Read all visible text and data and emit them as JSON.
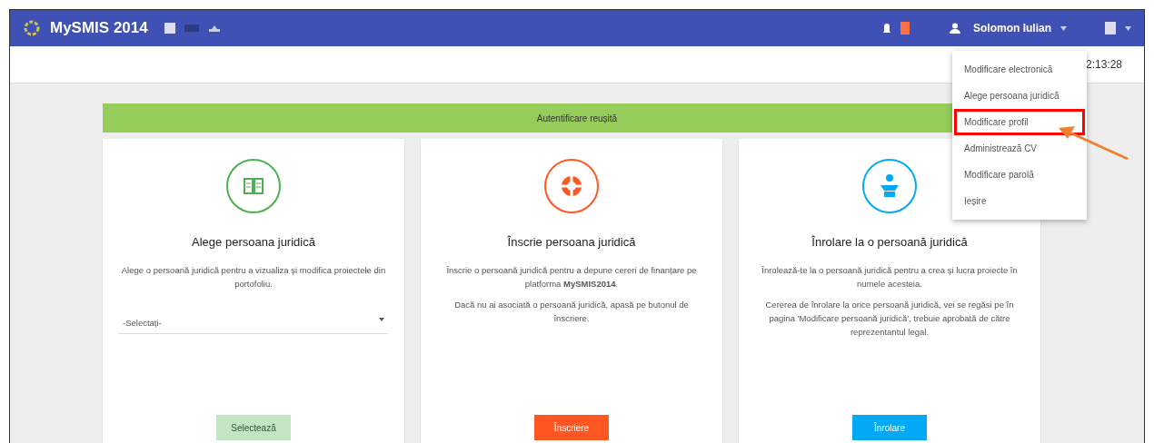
{
  "app_bar": {
    "title": "MySMIS 2014",
    "user_name": "Solomon Iulian"
  },
  "toolbar": {
    "time": "2:13:28"
  },
  "banner": {
    "text": "Autentificare reușită"
  },
  "user_menu": {
    "items": [
      {
        "label": "Modificare electronică",
        "selected": false
      },
      {
        "label": "Alege persoana juridică",
        "selected": false
      },
      {
        "label": "Modificare profil",
        "selected": true
      },
      {
        "label": "Administrează CV",
        "selected": false
      },
      {
        "label": "Modificare parolă",
        "selected": false
      },
      {
        "label": "Ieșire",
        "selected": false
      }
    ]
  },
  "cards": [
    {
      "kind": "select",
      "color": "#4caf50",
      "title": "Alege persoana juridică",
      "paragraphs": [
        "Alege o persoană juridică pentru a vizualiza și modifica proiectele din portofoliu."
      ],
      "placeholder": "-Selectați-",
      "button": {
        "label": "Selectează",
        "disabled": true
      }
    },
    {
      "kind": "register",
      "color": "#ff5722",
      "title": "Înscrie persoana juridică",
      "paragraphs": [
        "Înscrie o persoană juridică pentru a depune cereri de finanțare pe platforma **MySMIS2014**.",
        "Dacă nu ai asociată o persoană juridică, apasă pe butonul de înscriere."
      ],
      "button": {
        "label": "Înscriere",
        "disabled": false
      }
    },
    {
      "kind": "enroll",
      "color": "#03a9f4",
      "title": "Înrolare la o persoană juridică",
      "paragraphs": [
        "Înrolează-te la o persoană juridică pentru a crea și lucra proiecte în numele acesteia.",
        "Cererea de înrolare la orice persoană juridică, vei se regăsi pe în pagina 'Modificare persoană juridică', trebuie aprobată de către reprezentantul legal."
      ],
      "button": {
        "label": "Înrolare",
        "disabled": false
      }
    }
  ]
}
